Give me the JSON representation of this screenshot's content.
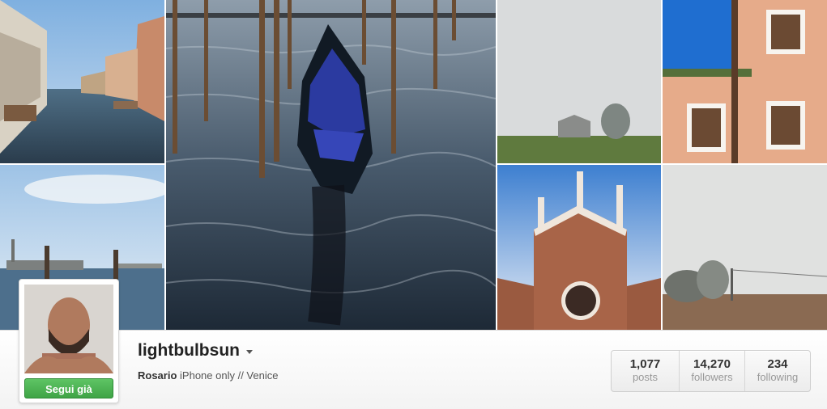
{
  "profile": {
    "username": "lightbulbsun",
    "full_name": "Rosario",
    "bio": "iPhone only // Venice",
    "follow_button_label": "Segui già",
    "follow_button_color": "#4caf50"
  },
  "stats": [
    {
      "value": "1,077",
      "label": "posts"
    },
    {
      "value": "14,270",
      "label": "followers"
    },
    {
      "value": "234",
      "label": "following"
    }
  ],
  "icons": {
    "dropdown": "chevron-down-icon"
  }
}
